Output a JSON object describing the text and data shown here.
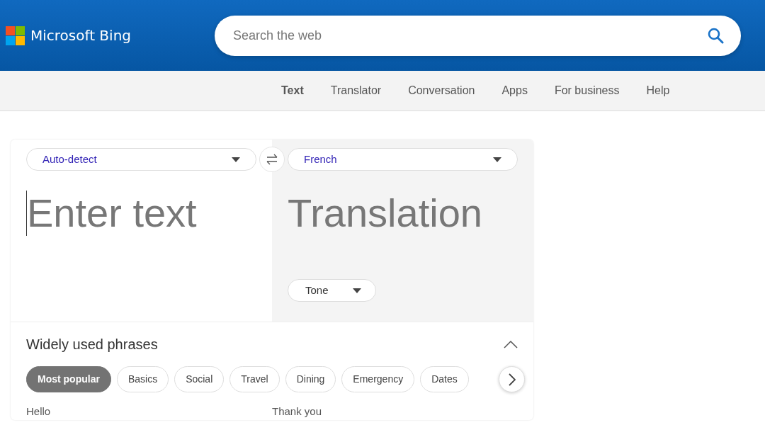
{
  "header": {
    "logo_text": "Microsoft Bing",
    "search": {
      "placeholder": "Search the web"
    }
  },
  "nav": [
    {
      "label": "Text",
      "selected": true
    },
    {
      "label": "Translator",
      "selected": false
    },
    {
      "label": "Conversation",
      "selected": false
    },
    {
      "label": "Apps",
      "selected": false
    },
    {
      "label": "For business",
      "selected": false
    },
    {
      "label": "Help",
      "selected": false
    }
  ],
  "translator": {
    "source_language": "Auto-detect",
    "target_language": "French",
    "input": {
      "placeholder": "Enter text"
    },
    "output_placeholder": "Translation",
    "tone": "Tone"
  },
  "phrases": {
    "title": "Widely used phrases",
    "expanded": true,
    "categories": [
      {
        "label": "Most popular",
        "selected": true
      },
      {
        "label": "Basics",
        "selected": false
      },
      {
        "label": "Social",
        "selected": false
      },
      {
        "label": "Travel",
        "selected": false
      },
      {
        "label": "Dining",
        "selected": false
      },
      {
        "label": "Emergency",
        "selected": false
      },
      {
        "label": "Dates",
        "selected": false
      }
    ],
    "items": [
      "Hello",
      "Thank you"
    ]
  }
}
